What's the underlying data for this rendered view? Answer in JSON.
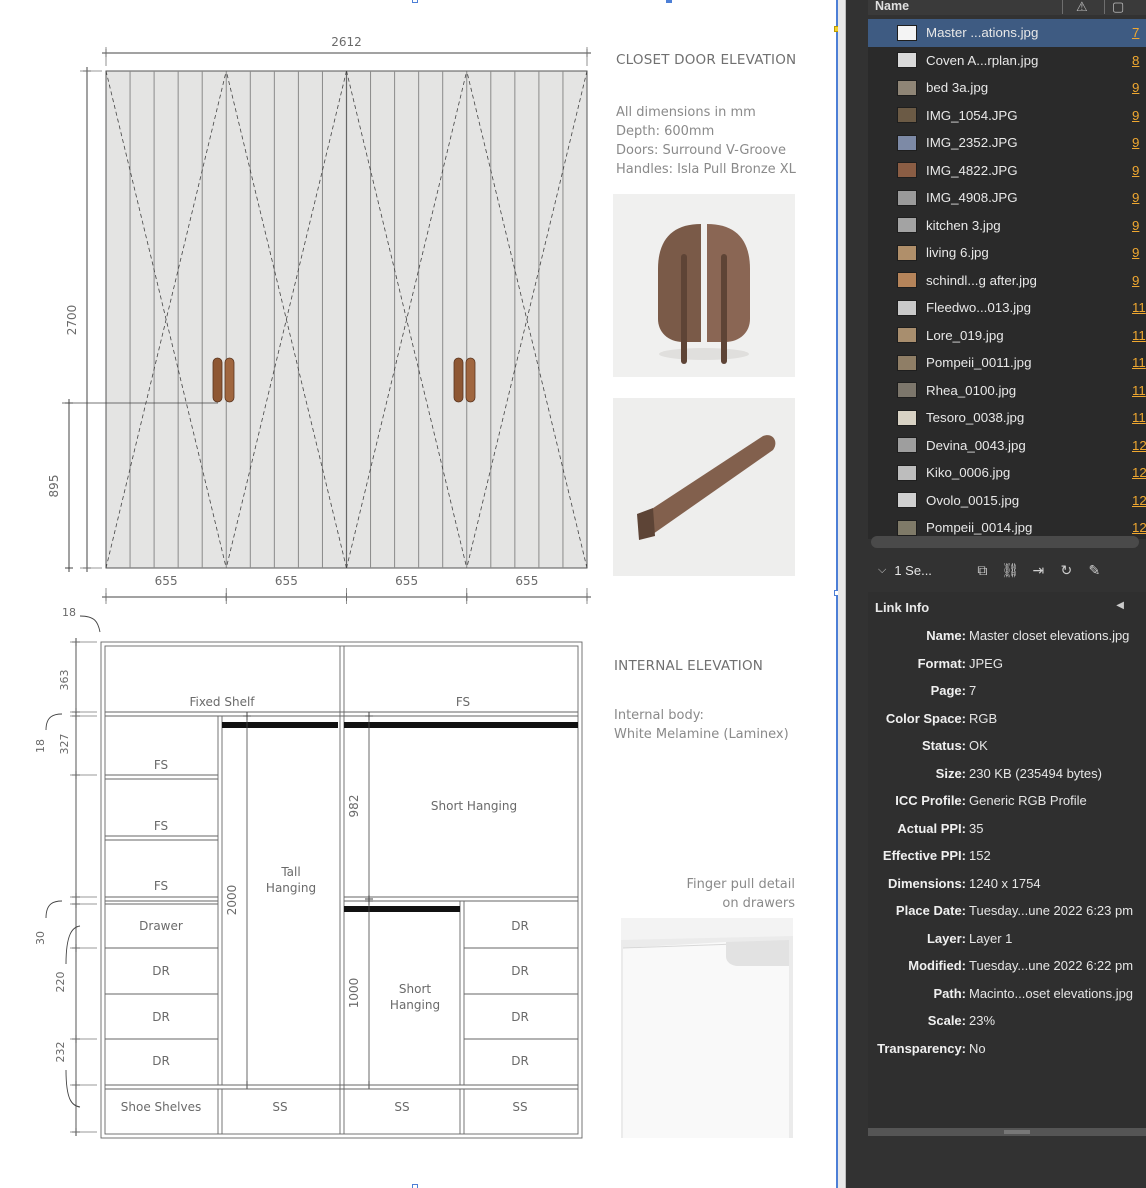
{
  "drawing": {
    "door": {
      "heading": "CLOSET DOOR ELEVATION",
      "notes": [
        "All dimensions in mm",
        "Depth: 600mm",
        "Doors: Surround V-Groove",
        "Handles: Isla Pull Bronze XL"
      ],
      "overall_width": "2612",
      "overall_height": "2700",
      "handle_height": "895",
      "door_widths": [
        "655",
        "655",
        "655",
        "655"
      ]
    },
    "internal": {
      "heading": "INTERNAL ELEVATION",
      "notes": [
        "Internal body:",
        "White Melamine (Laminex)"
      ],
      "finger_pull_caption": [
        "Finger pull detail",
        "on drawers"
      ],
      "top_gap": "18",
      "left_dims": [
        "363",
        "327",
        "18",
        "30",
        "220",
        "232"
      ],
      "mid_dims": [
        "2000",
        "982",
        "1000"
      ],
      "cells": {
        "fixed_shelf": "Fixed Shelf",
        "fs_top_right": "FS",
        "fs_left": [
          "FS",
          "FS",
          "FS"
        ],
        "drawer": "Drawer",
        "dr_left": [
          "DR",
          "DR",
          "DR"
        ],
        "tall_hanging": [
          "Tall",
          "Hanging"
        ],
        "short_hanging_top": "Short Hanging",
        "short_hanging_bottom": [
          "Short",
          "Hanging"
        ],
        "dr_right": [
          "DR",
          "DR",
          "DR",
          "DR"
        ],
        "shoe_shelves": "Shoe Shelves",
        "ss": [
          "SS",
          "SS",
          "SS"
        ]
      }
    }
  },
  "panel": {
    "column_name": "Name",
    "links": [
      {
        "name": "Master ...ations.jpg",
        "page": "7",
        "selected": true,
        "thumb": "#f4f4f4"
      },
      {
        "name": "Coven A...rplan.jpg",
        "page": "8",
        "selected": false,
        "thumb": "#d9d9d9"
      },
      {
        "name": "bed 3a.jpg",
        "page": "9",
        "selected": false,
        "thumb": "#8f8576"
      },
      {
        "name": "IMG_1054.JPG",
        "page": "9",
        "selected": false,
        "thumb": "#6b5a45"
      },
      {
        "name": "IMG_2352.JPG",
        "page": "9",
        "selected": false,
        "thumb": "#7d8aa6"
      },
      {
        "name": "IMG_4822.JPG",
        "page": "9",
        "selected": false,
        "thumb": "#8a5d44"
      },
      {
        "name": "IMG_4908.JPG",
        "page": "9",
        "selected": false,
        "thumb": "#9a9a9a"
      },
      {
        "name": "kitchen 3.jpg",
        "page": "9",
        "selected": false,
        "thumb": "#a3a3a3"
      },
      {
        "name": "living 6.jpg",
        "page": "9",
        "selected": false,
        "thumb": "#b08f6a"
      },
      {
        "name": "schindl...g after.jpg",
        "page": "9",
        "selected": false,
        "thumb": "#b5845a"
      },
      {
        "name": "Fleedwo...013.jpg",
        "page": "11",
        "selected": false,
        "thumb": "#c9c9c9"
      },
      {
        "name": "Lore_019.jpg",
        "page": "11",
        "selected": false,
        "thumb": "#a88e6e"
      },
      {
        "name": "Pompeii_0011.jpg",
        "page": "11",
        "selected": false,
        "thumb": "#8f7e66"
      },
      {
        "name": "Rhea_0100.jpg",
        "page": "11",
        "selected": false,
        "thumb": "#7c766b"
      },
      {
        "name": "Tesoro_0038.jpg",
        "page": "11",
        "selected": false,
        "thumb": "#d8d2c4"
      },
      {
        "name": "Devina_0043.jpg",
        "page": "12",
        "selected": false,
        "thumb": "#9e9e9e"
      },
      {
        "name": "Kiko_0006.jpg",
        "page": "12",
        "selected": false,
        "thumb": "#bdbdbd"
      },
      {
        "name": "Ovolo_0015.jpg",
        "page": "12",
        "selected": false,
        "thumb": "#cfcfcf"
      },
      {
        "name": "Pompeii_0014.jpg",
        "page": "12",
        "selected": false,
        "thumb": "#7f7a68"
      }
    ],
    "selection_count": "1 Se...",
    "link_info": {
      "header": "Link Info",
      "rows": [
        {
          "label": "Name:",
          "value": "Master closet elevations.jpg"
        },
        {
          "label": "Format:",
          "value": "JPEG"
        },
        {
          "label": "Page:",
          "value": "7"
        },
        {
          "label": "Color Space:",
          "value": "RGB"
        },
        {
          "label": "Status:",
          "value": "OK"
        },
        {
          "label": "Size:",
          "value": "230 KB (235494 bytes)"
        },
        {
          "label": "ICC Profile:",
          "value": "Generic RGB Profile"
        },
        {
          "label": "Actual PPI:",
          "value": "35"
        },
        {
          "label": "Effective PPI:",
          "value": "152"
        },
        {
          "label": "Dimensions:",
          "value": "1240 x 1754"
        },
        {
          "label": "Place Date:",
          "value": "Tuesday...une 2022 6:23 pm"
        },
        {
          "label": "Layer:",
          "value": "Layer 1"
        },
        {
          "label": "Modified:",
          "value": "Tuesday...une 2022 6:22 pm"
        },
        {
          "label": "Path:",
          "value": "Macinto...oset elevations.jpg"
        },
        {
          "label": "Scale:",
          "value": "23%"
        },
        {
          "label": "Transparency:",
          "value": "No"
        }
      ]
    }
  }
}
